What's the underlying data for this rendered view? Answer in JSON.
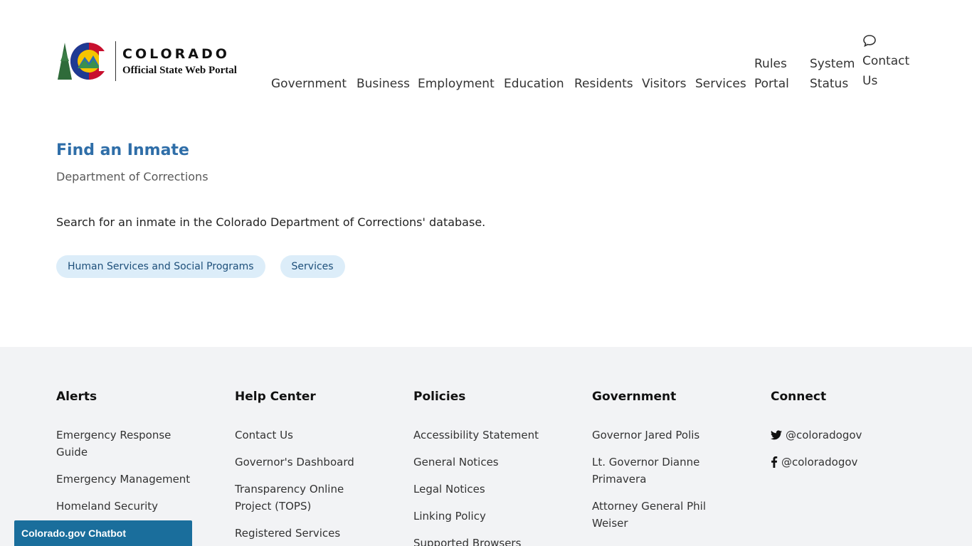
{
  "header": {
    "logo": {
      "title": "COLORADO",
      "subtitle": "Official State Web Portal"
    },
    "nav": [
      {
        "label": "Government"
      },
      {
        "label": "Business"
      },
      {
        "label": "Employment"
      },
      {
        "label": "Education"
      },
      {
        "label": "Residents"
      },
      {
        "label": "Visitors"
      },
      {
        "label": "Services"
      },
      {
        "label": "Rules Portal"
      },
      {
        "label": "System Status"
      },
      {
        "label": "Contact Us"
      }
    ],
    "contact_icon": "speech-bubble-icon"
  },
  "main": {
    "title": "Find an Inmate",
    "subtitle": "Department of Corrections",
    "description": "Search for an inmate in the Colorado Department of Corrections' database.",
    "tags": [
      {
        "label": "Human Services and Social Programs"
      },
      {
        "label": "Services"
      }
    ]
  },
  "footer": {
    "columns": [
      {
        "heading": "Alerts",
        "links": [
          "Emergency Response Guide",
          "Emergency Management",
          "Homeland Security"
        ]
      },
      {
        "heading": "Help Center",
        "links": [
          "Contact Us",
          "Governor's Dashboard",
          "Transparency Online Project (TOPS)",
          "Registered Services"
        ]
      },
      {
        "heading": "Policies",
        "links": [
          "Accessibility Statement",
          "General Notices",
          "Legal Notices",
          "Linking Policy",
          "Supported Browsers"
        ]
      },
      {
        "heading": "Government",
        "links": [
          "Governor Jared Polis",
          "Lt. Governor Dianne Primavera",
          "Attorney General Phil Weiser"
        ]
      },
      {
        "heading": "Connect",
        "links": [
          "@coloradogov",
          "@coloradogov"
        ],
        "icons": [
          "twitter-icon",
          "facebook-icon"
        ]
      }
    ]
  },
  "chatbot": {
    "label": "Colorado.gov Chatbot"
  },
  "colors": {
    "title_blue": "#2f6ea8",
    "tag_bg": "#dcedf9",
    "footer_bg": "#f2f3f5",
    "chatbot_bg": "#1a6e9c"
  }
}
